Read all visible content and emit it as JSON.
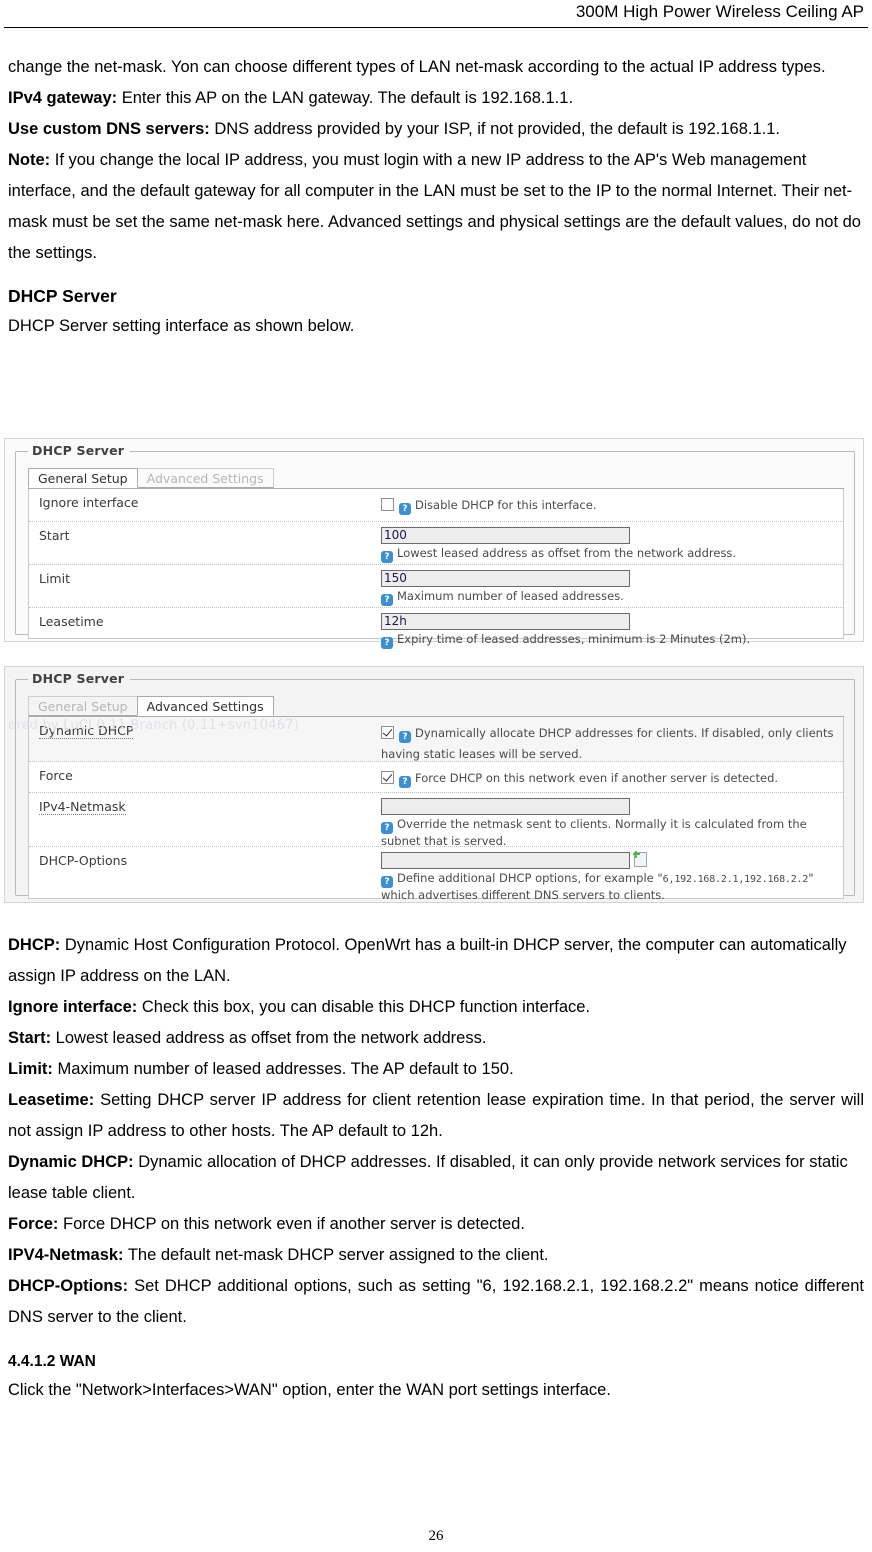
{
  "header": {
    "title": "300M High Power Wireless Ceiling AP"
  },
  "body": {
    "para_continuation": "change the net-mask. Yon can choose different types of LAN net-mask according to the actual IP address types.",
    "ipv4_gateway_label": "IPv4 gateway:",
    "ipv4_gateway_text": " Enter this AP on the LAN gateway. The default is 192.168.1.1.",
    "dns_label": "Use custom DNS servers:",
    "dns_text": " DNS address provided by your ISP, if not provided, the default is 192.168.1.1.",
    "note_label": "Note:",
    "note_text": " If you change the local IP address, you must login with a new IP address to the AP's Web management interface, and the default gateway for all computer in the LAN must be set to the IP to the normal Internet. Their net-mask must be set the same net-mask here. Advanced settings and physical settings are the default values, do not do the settings.",
    "section_heading": "DHCP Server",
    "section_intro": "DHCP Server setting interface as shown below."
  },
  "screenshot_general": {
    "legend": "DHCP Server",
    "tabs": [
      {
        "label": "General Setup",
        "active": true
      },
      {
        "label": "Advanced Settings",
        "active": false
      }
    ],
    "rows": [
      {
        "label": "Ignore interface",
        "control": "checkbox",
        "checked": false,
        "hint": "Disable DHCP for this interface."
      },
      {
        "label": "Start",
        "control": "text",
        "value": "100",
        "hint": "Lowest leased address as offset from the network address."
      },
      {
        "label": "Limit",
        "control": "text",
        "value": "150",
        "hint": "Maximum number of leased addresses."
      },
      {
        "label": "Leasetime",
        "control": "text",
        "value": "12h",
        "hint": "Expiry time of leased addresses, minimum is 2 Minutes (2m)."
      }
    ]
  },
  "screenshot_advanced": {
    "legend": "DHCP Server",
    "ghost_watermark": "ered by LuCI 0.11 Branch (0.11+svn10467)",
    "tabs": [
      {
        "label": "General Setup",
        "active": false
      },
      {
        "label": "Advanced Settings",
        "active": true
      }
    ],
    "rows": [
      {
        "label": "Dynamic DHCP",
        "control": "checkbox",
        "checked": true,
        "hint": "Dynamically allocate DHCP addresses for clients. If disabled, only clients having static leases will be served."
      },
      {
        "label": "Force",
        "control": "checkbox",
        "checked": true,
        "hint": "Force DHCP on this network even if another server is detected."
      },
      {
        "label": "IPv4-Netmask",
        "control": "text",
        "value": "",
        "hint": "Override the netmask sent to clients. Normally it is calculated from the subnet that is served."
      },
      {
        "label": "DHCP-Options",
        "control": "text-with-add",
        "value": "",
        "hint_pre": "Define additional DHCP options, for example \"",
        "hint_mono": "6,192.168.2.1,192.168.2.2",
        "hint_post": "\" which advertises different DNS servers to clients."
      }
    ]
  },
  "definitions": [
    {
      "term": "DHCP:",
      "text": " Dynamic Host Configuration Protocol. OpenWrt has a built-in DHCP server, the computer can automatically assign IP address on the LAN."
    },
    {
      "term": "Ignore interface:",
      "text": " Check this box, you can disable this DHCP function interface."
    },
    {
      "term": "Start:",
      "text": " Lowest leased address as offset from the network address."
    },
    {
      "term": "Limit:",
      "text": " Maximum number of leased addresses. The AP default to 150."
    },
    {
      "term": "Leasetime:",
      "text": " Setting DHCP server IP address for client retention lease expiration time. In that period, the server will not assign IP address to other hosts. The AP default to 12h."
    },
    {
      "term": "Dynamic DHCP:",
      "text": " Dynamic allocation of DHCP addresses. If disabled, it can only provide network services for static lease table client."
    },
    {
      "term": "Force:",
      "text": " Force DHCP on this network even if another server is detected."
    },
    {
      "term": "IPV4-Netmask:",
      "text": " The default net-mask DHCP server assigned to the client."
    },
    {
      "term": "DHCP-Options:",
      "text": " Set DHCP additional options, such as setting \"6, 192.168.2.1, 192.168.2.2\" means notice different DNS server to the client."
    }
  ],
  "wan_section": {
    "heading": "4.4.1.2 WAN",
    "text": "Click the \"Network>Interfaces>WAN\" option, enter the WAN port settings interface."
  },
  "footer": {
    "page_number": "26"
  }
}
